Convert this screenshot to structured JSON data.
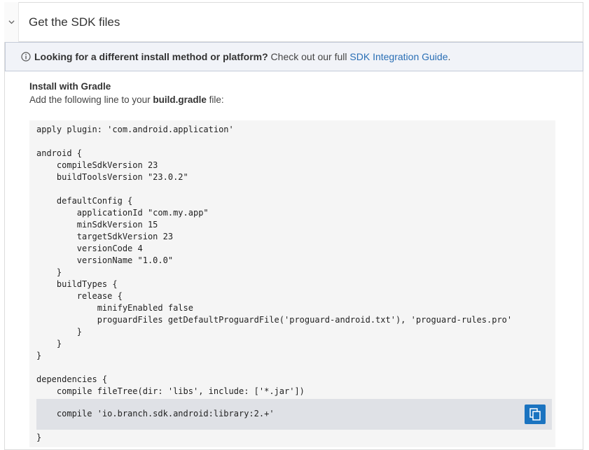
{
  "section": {
    "title": "Get the SDK files"
  },
  "notice": {
    "bold_text": "Looking for a different install method or platform?",
    "text": " Check out our full ",
    "link_text": "SDK Integration Guide",
    "suffix": "."
  },
  "install": {
    "heading": "Install with Gradle",
    "instruction_prefix": "Add the following line to your ",
    "instruction_file": "build.gradle",
    "instruction_suffix": " file:"
  },
  "code": {
    "lines": [
      "apply plugin: 'com.android.application'",
      "",
      "android {",
      "    compileSdkVersion 23",
      "    buildToolsVersion \"23.0.2\"",
      "",
      "    defaultConfig {",
      "        applicationId \"com.my.app\"",
      "        minSdkVersion 15",
      "        targetSdkVersion 23",
      "        versionCode 4",
      "        versionName \"1.0.0\"",
      "    }",
      "    buildTypes {",
      "        release {",
      "            minifyEnabled false",
      "            proguardFiles getDefaultProguardFile('proguard-android.txt'), 'proguard-rules.pro'",
      "        }",
      "    }",
      "}",
      "",
      "dependencies {",
      "    compile fileTree(dir: 'libs', include: ['*.jar'])",
      "",
      "    compile 'io.branch.sdk.android:library:2.+'",
      "",
      "}"
    ],
    "highlighted_line": "    compile 'io.branch.sdk.android:library:2.+'"
  },
  "icons": {
    "toggle": "chevron-down-icon",
    "info": "info-circle-icon",
    "copy": "copy-icon"
  },
  "colors": {
    "accent": "#1a73c0",
    "link": "#2a6fb5",
    "notice_bg": "#f1f3f8",
    "code_bg": "#f5f5f5",
    "highlight_bg": "#dfe1e6"
  }
}
